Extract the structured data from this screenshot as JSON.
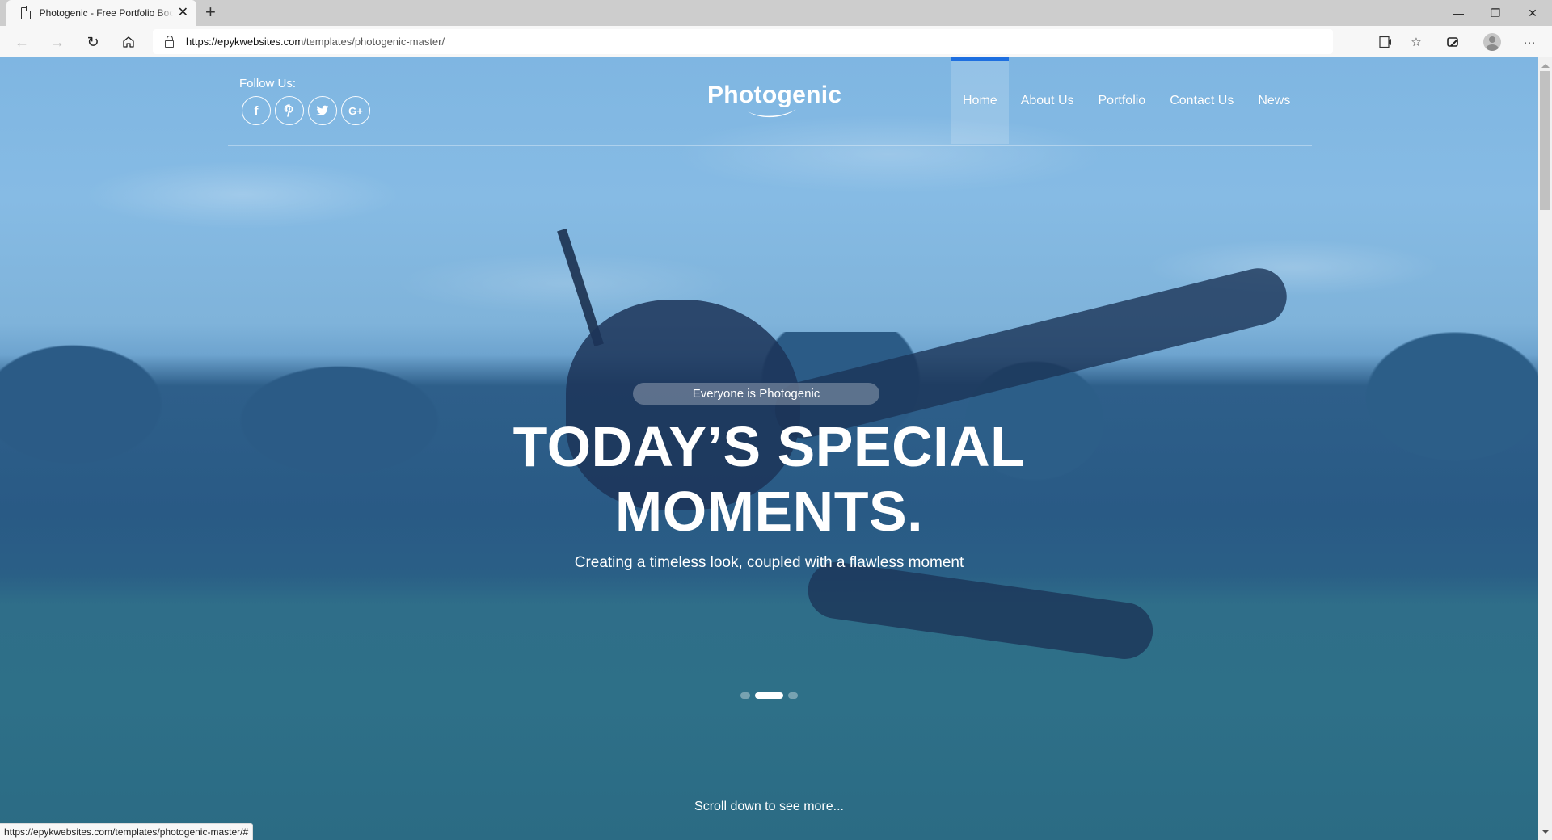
{
  "browser": {
    "tab_title": "Photogenic - Free Portfolio Bootstrap Template",
    "tab_close_icon": "close-icon",
    "new_tab_icon": "plus-icon",
    "url_scheme_host": "https://epykwebsites.com",
    "url_path": "/templates/photogenic-master/",
    "status_url": "https://epykwebsites.com/templates/photogenic-master/#",
    "icons": {
      "back": "arrow-left-icon",
      "forward": "arrow-right-icon",
      "refresh": "refresh-icon",
      "home": "home-icon",
      "lock": "lock-icon",
      "read_aloud": "read-aloud-icon",
      "add_favorite": "star-plus-icon",
      "collections": "collections-icon",
      "profile": "avatar-icon",
      "more": "more-icon"
    },
    "window_controls": {
      "minimize": "—",
      "restore": "❐",
      "close": "✕"
    }
  },
  "site": {
    "follow_label": "Follow Us:",
    "socials": [
      {
        "name": "facebook",
        "glyph": "f"
      },
      {
        "name": "pinterest",
        "glyph": "P"
      },
      {
        "name": "twitter",
        "glyph": "🐦"
      },
      {
        "name": "google-plus",
        "glyph": "G+"
      }
    ],
    "logo": "Photogenic",
    "nav": [
      {
        "label": "Home",
        "active": true
      },
      {
        "label": "About Us",
        "active": false
      },
      {
        "label": "Portfolio",
        "active": false
      },
      {
        "label": "Contact Us",
        "active": false
      },
      {
        "label": "News",
        "active": false
      }
    ],
    "accent_color": "#1e6fe0"
  },
  "hero": {
    "tagline": "Everyone is Photogenic",
    "headline_line1": "TODAY’S SPECIAL",
    "headline_line2": "MOMENTS.",
    "subtitle": "Creating a timeless look, coupled with a flawless moment",
    "slides_total": 3,
    "active_slide": 2,
    "scroll_hint": "Scroll down to see more..."
  }
}
